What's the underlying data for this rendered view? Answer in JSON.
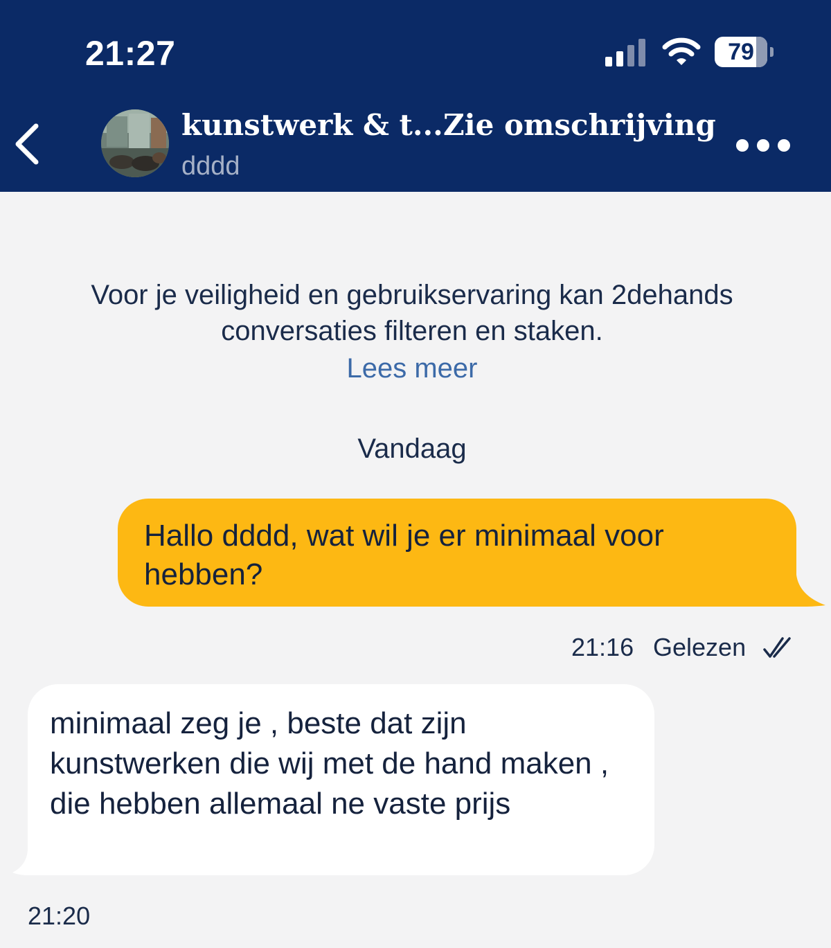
{
  "status_bar": {
    "time": "21:27",
    "battery_level": "79",
    "battery_percent": 79,
    "icons": [
      "signal-icon",
      "wifi-icon",
      "battery-icon"
    ]
  },
  "header": {
    "back_icon": "chevron-left-icon",
    "listing_title": "kunstwerk & t...",
    "see_description": "Zie omschrijving",
    "contact_name": "dddd",
    "more_icon": "more-horizontal-icon"
  },
  "notice": {
    "text": "Voor je veiligheid en gebruikservaring kan 2dehands conversaties filteren en staken.",
    "read_more": "Lees meer"
  },
  "conversation": {
    "date_separator": "Vandaag",
    "messages": [
      {
        "direction": "outgoing",
        "text": "Hallo dddd, wat wil je er minimaal voor hebben?",
        "time": "21:16",
        "status": "Gelezen",
        "status_icon": "double-check-icon"
      },
      {
        "direction": "incoming",
        "text": "minimaal zeg je , beste dat zijn kunstwerken die wij met de hand maken , die hebben allemaal ne vaste prijs",
        "time": "21:20"
      }
    ]
  },
  "colors": {
    "header_background": "#0b2a66",
    "chat_background": "#f3f3f4",
    "outgoing_bubble": "#fdb813",
    "incoming_bubble": "#ffffff",
    "link": "#3c6aa8",
    "text": "#15223d"
  }
}
